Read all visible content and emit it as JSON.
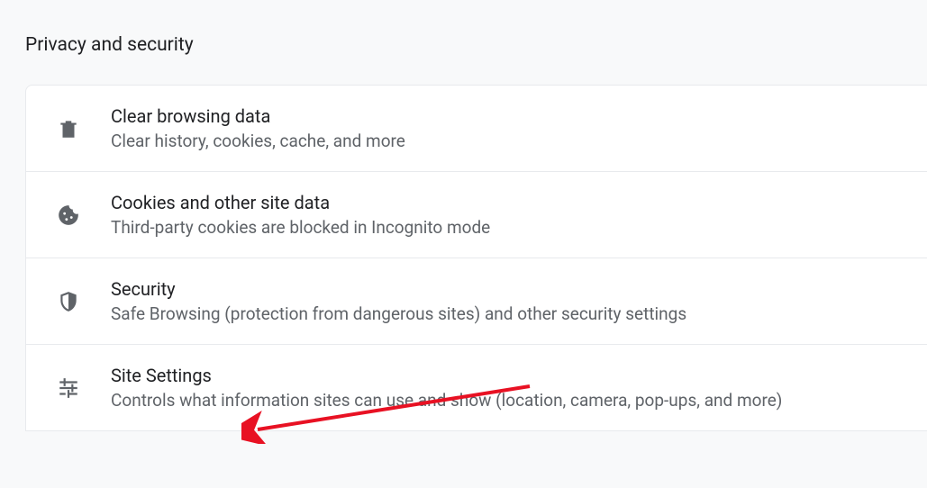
{
  "title": "Privacy and security",
  "rows": [
    {
      "icon": "trash-icon",
      "title": "Clear browsing data",
      "desc": "Clear history, cookies, cache, and more"
    },
    {
      "icon": "cookie-icon",
      "title": "Cookies and other site data",
      "desc": "Third-party cookies are blocked in Incognito mode"
    },
    {
      "icon": "shield-icon",
      "title": "Security",
      "desc": "Safe Browsing (protection from dangerous sites) and other security settings"
    },
    {
      "icon": "sliders-icon",
      "title": "Site Settings",
      "desc": "Controls what information sites can use and show (location, camera, pop-ups, and more)"
    }
  ]
}
